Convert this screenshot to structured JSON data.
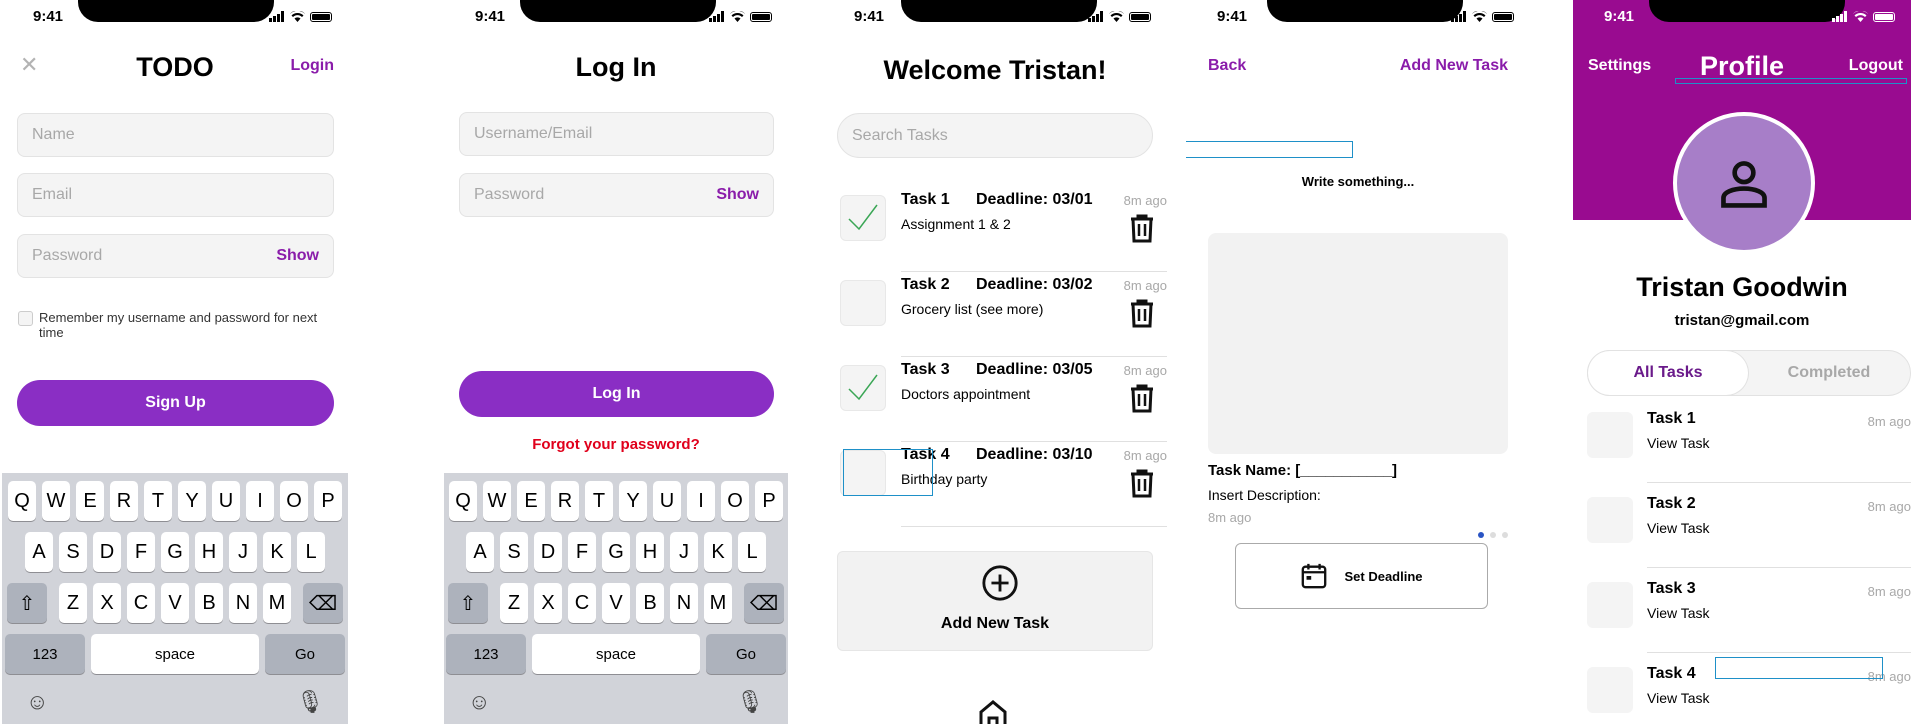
{
  "status": {
    "time": "9:41"
  },
  "signup": {
    "close_icon": "close-icon",
    "title": "TODO",
    "login_link": "Login",
    "name_placeholder": "Name",
    "email_placeholder": "Email",
    "password_placeholder": "Password",
    "show_label": "Show",
    "remember_label": "Remember my username and password for next time",
    "signup_button": "Sign Up"
  },
  "login": {
    "title": "Log In",
    "username_placeholder": "Username/Email",
    "password_placeholder": "Password",
    "show_label": "Show",
    "login_button": "Log In",
    "forgot_link": "Forgot your password?"
  },
  "keyboard": {
    "row1": [
      "Q",
      "W",
      "E",
      "R",
      "T",
      "Y",
      "U",
      "I",
      "O",
      "P"
    ],
    "row2": [
      "A",
      "S",
      "D",
      "F",
      "G",
      "H",
      "J",
      "K",
      "L"
    ],
    "row3": [
      "Z",
      "X",
      "C",
      "V",
      "B",
      "N",
      "M"
    ],
    "numbers_key": "123",
    "space_key": "space",
    "go_key": "Go"
  },
  "tasks_screen": {
    "title": "Welcome Tristan!",
    "search_placeholder": "Search Tasks",
    "tasks": [
      {
        "name": "Task 1",
        "deadline": "Deadline: 03/01",
        "ago": "8m ago",
        "desc": "Assignment 1 & 2",
        "checked": true
      },
      {
        "name": "Task 2",
        "deadline": "Deadline: 03/02",
        "ago": "8m ago",
        "desc": "Grocery list (see more)",
        "checked": false
      },
      {
        "name": "Task 3",
        "deadline": "Deadline: 03/05",
        "ago": "8m ago",
        "desc": "Doctors appointment",
        "checked": true
      },
      {
        "name": "Task 4",
        "deadline": "Deadline: 03/10",
        "ago": "8m ago",
        "desc": "Birthday party",
        "checked": false
      }
    ],
    "add_task_label": "Add New Task"
  },
  "new_task": {
    "back": "Back",
    "add_new_task": "Add New Task",
    "write_something": "Write something...",
    "task_name_label": "Task Name: [___________]",
    "insert_description": "Insert Description:",
    "ago": "8m ago",
    "set_deadline": "Set Deadline"
  },
  "profile": {
    "settings": "Settings",
    "title": "Profile",
    "logout": "Logout",
    "name": "Tristan Goodwin",
    "email": "tristan@gmail.com",
    "tab_all": "All Tasks",
    "tab_completed": "Completed",
    "tasks": [
      {
        "name": "Task 1",
        "view": "View Task",
        "ago": "8m ago"
      },
      {
        "name": "Task 2",
        "view": "View Task",
        "ago": "8m ago"
      },
      {
        "name": "Task 3",
        "view": "View Task",
        "ago": "8m ago"
      },
      {
        "name": "Task 4",
        "view": "View Task",
        "ago": "8m ago"
      }
    ]
  },
  "colors": {
    "brand_purple": "#8a2ec4",
    "link_purple": "#8a1caa",
    "profile_header": "#990b90",
    "forgot_red": "#e0001b",
    "check_green": "#3aa655"
  }
}
